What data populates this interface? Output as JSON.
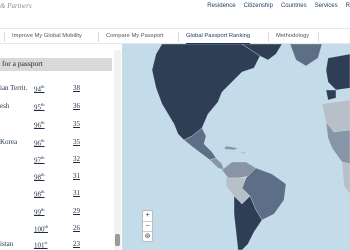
{
  "header": {
    "brand": "& Partners",
    "nav": [
      "Residence",
      "Citizenship",
      "Countries",
      "Services",
      "R"
    ]
  },
  "tabs": [
    {
      "label": "Improve My Global Mobility",
      "active": false
    },
    {
      "label": "Compare My Passport",
      "active": false
    },
    {
      "label": "Global Passport Ranking",
      "active": true
    },
    {
      "label": "Methodology",
      "active": false
    }
  ],
  "panel": {
    "heading": "for a passport"
  },
  "rows": [
    {
      "country": "ian Territ.",
      "rank": "94",
      "suffix": "th",
      "score": "38"
    },
    {
      "country": "esh",
      "rank": "95",
      "suffix": "th",
      "score": "36"
    },
    {
      "country": "",
      "rank": "96",
      "suffix": "th",
      "score": "35"
    },
    {
      "country": "Korea",
      "rank": "96",
      "suffix": "th",
      "score": "35"
    },
    {
      "country": "",
      "rank": "97",
      "suffix": "th",
      "score": "32"
    },
    {
      "country": "",
      "rank": "98",
      "suffix": "th",
      "score": "31"
    },
    {
      "country": "",
      "rank": "98",
      "suffix": "th",
      "score": "31"
    },
    {
      "country": "",
      "rank": "99",
      "suffix": "th",
      "score": "29"
    },
    {
      "country": "",
      "rank": "100",
      "suffix": "th",
      "score": "26"
    },
    {
      "country": "istan",
      "rank": "101",
      "suffix": "st",
      "score": "23"
    }
  ],
  "map": {
    "zoom_in": "+",
    "zoom_out": "−",
    "reset": "⊚",
    "colors": {
      "ocean": "#c4dcea",
      "land_high": "#2e3e55",
      "land_mid": "#5d6f86",
      "land_low": "#b7bfc9",
      "land_light": "#dfe3e8"
    }
  }
}
